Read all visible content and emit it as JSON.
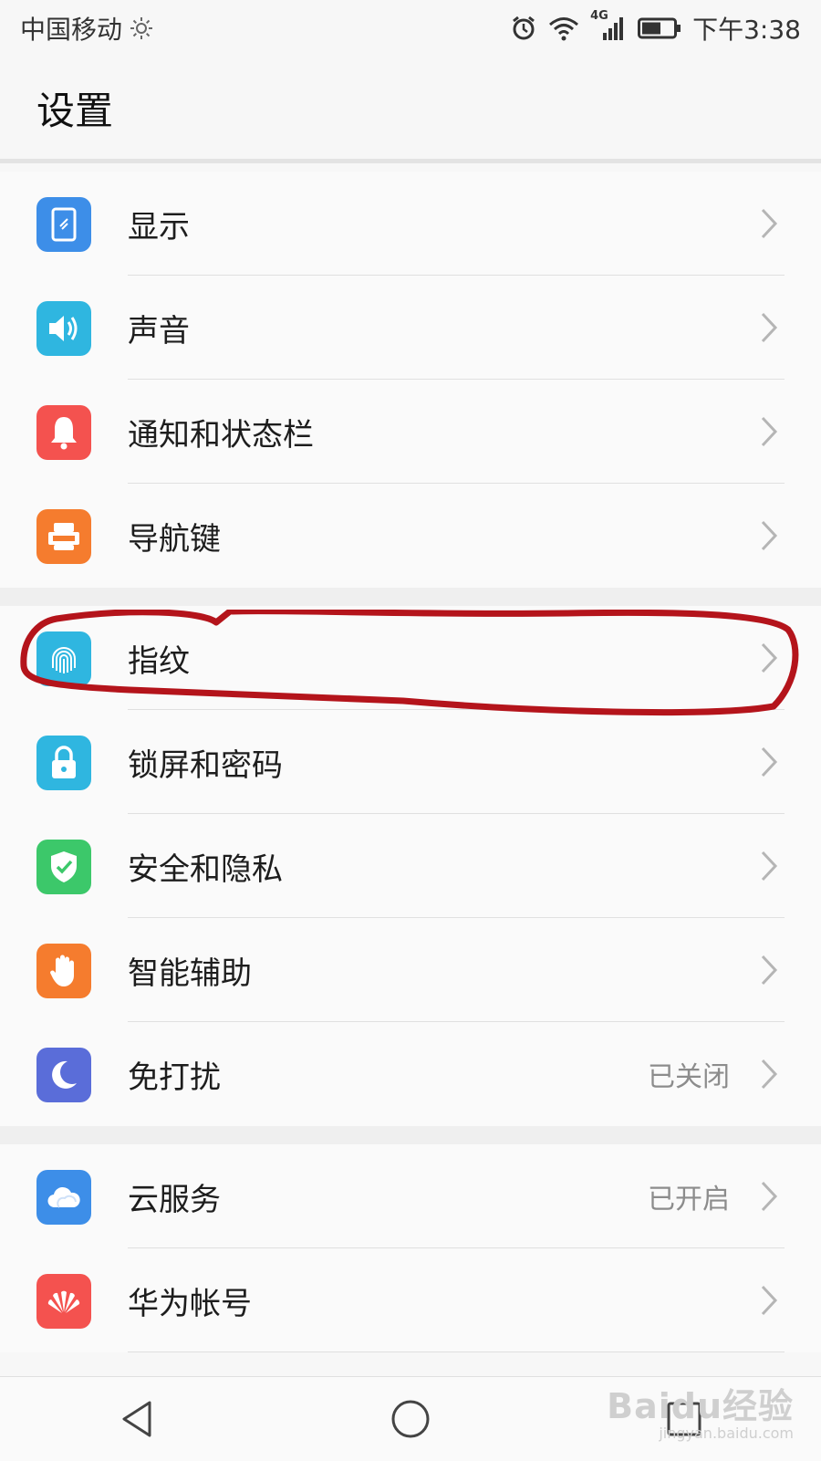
{
  "status_bar": {
    "carrier": "中国移动",
    "network": "4G",
    "time": "下午3:38"
  },
  "header": {
    "title": "设置"
  },
  "groups": [
    {
      "items": [
        {
          "label": "显示",
          "value": "",
          "icon": "display-icon",
          "color": "#3d8ee8"
        },
        {
          "label": "声音",
          "value": "",
          "icon": "sound-icon",
          "color": "#2fb6e0"
        },
        {
          "label": "通知和状态栏",
          "value": "",
          "icon": "bell-icon",
          "color": "#f4524f"
        },
        {
          "label": "导航键",
          "value": "",
          "icon": "navigation-key-icon",
          "color": "#f57c2e"
        }
      ]
    },
    {
      "items": [
        {
          "label": "指纹",
          "value": "",
          "icon": "fingerprint-icon",
          "color": "#2fb6e0"
        },
        {
          "label": "锁屏和密码",
          "value": "",
          "icon": "lock-icon",
          "color": "#2fb6e0"
        },
        {
          "label": "安全和隐私",
          "value": "",
          "icon": "shield-icon",
          "color": "#3cc86a"
        },
        {
          "label": "智能辅助",
          "value": "",
          "icon": "hand-icon",
          "color": "#f57c2e"
        },
        {
          "label": "免打扰",
          "value": "已关闭",
          "icon": "moon-icon",
          "color": "#5a6dd9"
        }
      ]
    },
    {
      "items": [
        {
          "label": "云服务",
          "value": "已开启",
          "icon": "cloud-icon",
          "color": "#3d8ee8"
        },
        {
          "label": "华为帐号",
          "value": "",
          "icon": "huawei-icon",
          "color": "#f4524f"
        }
      ]
    }
  ],
  "watermark": {
    "brand": "Baidu经验",
    "url": "jingyan.baidu.com"
  }
}
